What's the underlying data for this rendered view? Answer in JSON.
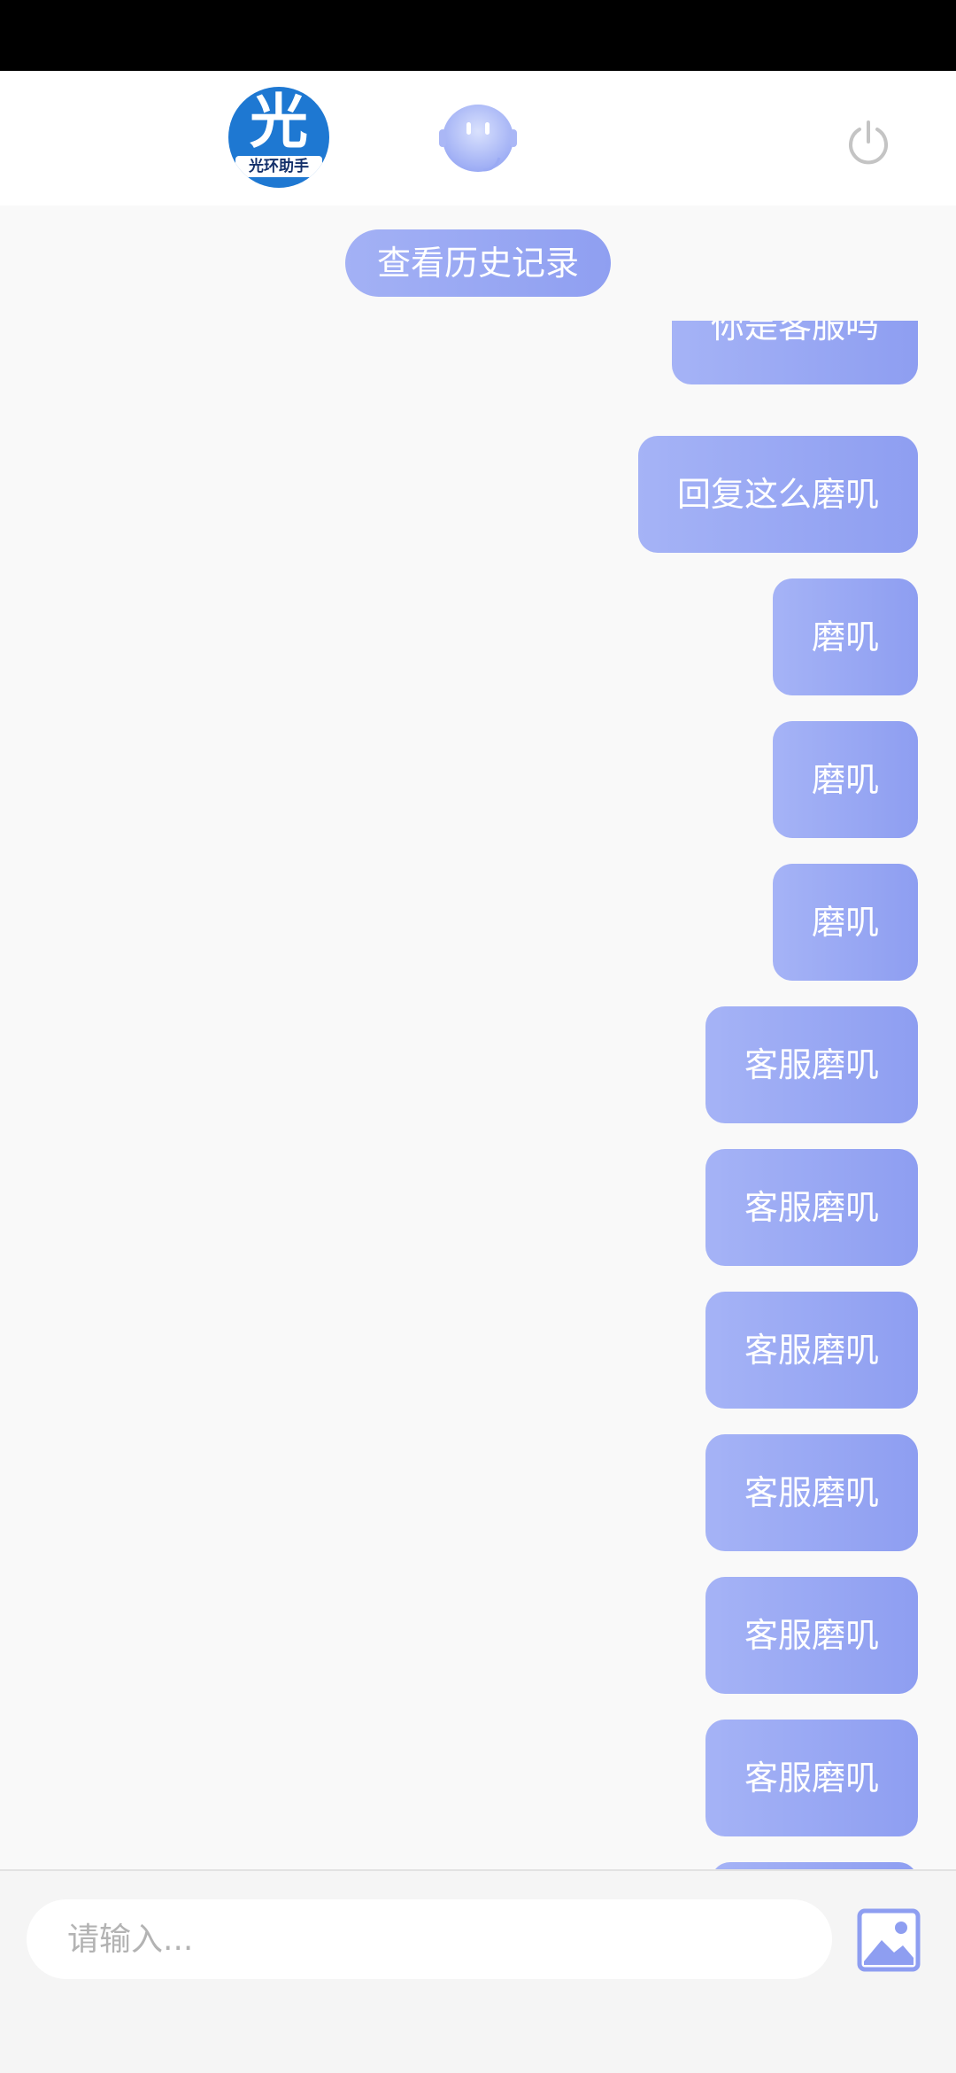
{
  "header": {
    "logo_char": "光",
    "logo_text": "光环助手",
    "bot_avatar_icon": "robot-face-icon",
    "power_icon": "power-icon"
  },
  "chat": {
    "history_label": "查看历史记录",
    "messages": [
      {
        "text": "你是客服吗",
        "sender": "user"
      },
      {
        "text": "回复这么磨叽",
        "sender": "user"
      },
      {
        "text": "磨叽",
        "sender": "user"
      },
      {
        "text": "磨叽",
        "sender": "user"
      },
      {
        "text": "磨叽",
        "sender": "user"
      },
      {
        "text": "客服磨叽",
        "sender": "user"
      },
      {
        "text": "客服磨叽",
        "sender": "user"
      },
      {
        "text": "客服磨叽",
        "sender": "user"
      },
      {
        "text": "客服磨叽",
        "sender": "user"
      },
      {
        "text": "客服磨叽",
        "sender": "user"
      },
      {
        "text": "客服磨叽",
        "sender": "user"
      },
      {
        "text": "",
        "sender": "user"
      }
    ]
  },
  "input": {
    "placeholder": "请输入...",
    "value": "",
    "image_icon": "image-icon"
  },
  "colors": {
    "bubble": "#95a5f3",
    "logo": "#1e78d2",
    "status_bar": "#000000"
  }
}
